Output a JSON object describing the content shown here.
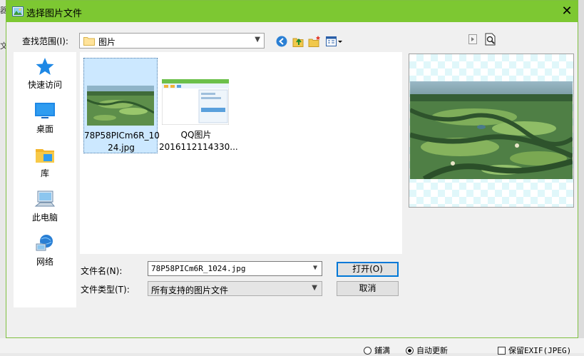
{
  "background": {
    "left_fragments": [
      "器",
      "文"
    ],
    "bottom_options": [
      "鋪满",
      "自动更新",
      "保留EXIF(JPEG)"
    ]
  },
  "dialog": {
    "title": "选择图片文件",
    "close_glyph": "✕",
    "look_in_label": "查找范围(I):",
    "look_in_value": "图片",
    "places": [
      {
        "label": "快速访问",
        "icon": "star-icon"
      },
      {
        "label": "桌面",
        "icon": "desktop-icon"
      },
      {
        "label": "库",
        "icon": "library-icon"
      },
      {
        "label": "此电脑",
        "icon": "computer-icon"
      },
      {
        "label": "网络",
        "icon": "network-icon"
      }
    ],
    "files": [
      {
        "name": "78P58PICm6R_1024.jpg",
        "line1": "78P58PICm6R_10",
        "line2": "24.jpg",
        "selected": true
      },
      {
        "name": "QQ图片2016112114330...",
        "line1": "QQ图片",
        "line2": "2016112114330...",
        "selected": false
      }
    ],
    "filename_label": "文件名(N):",
    "filename_value": "78P58PICm6R_1024.jpg",
    "filetype_label": "文件类型(T):",
    "filetype_value": "所有支持的图片文件",
    "open_button": "打开(O)",
    "cancel_button": "取消"
  },
  "colors": {
    "titlebar": "#7dc832",
    "selection": "#cce8ff"
  }
}
